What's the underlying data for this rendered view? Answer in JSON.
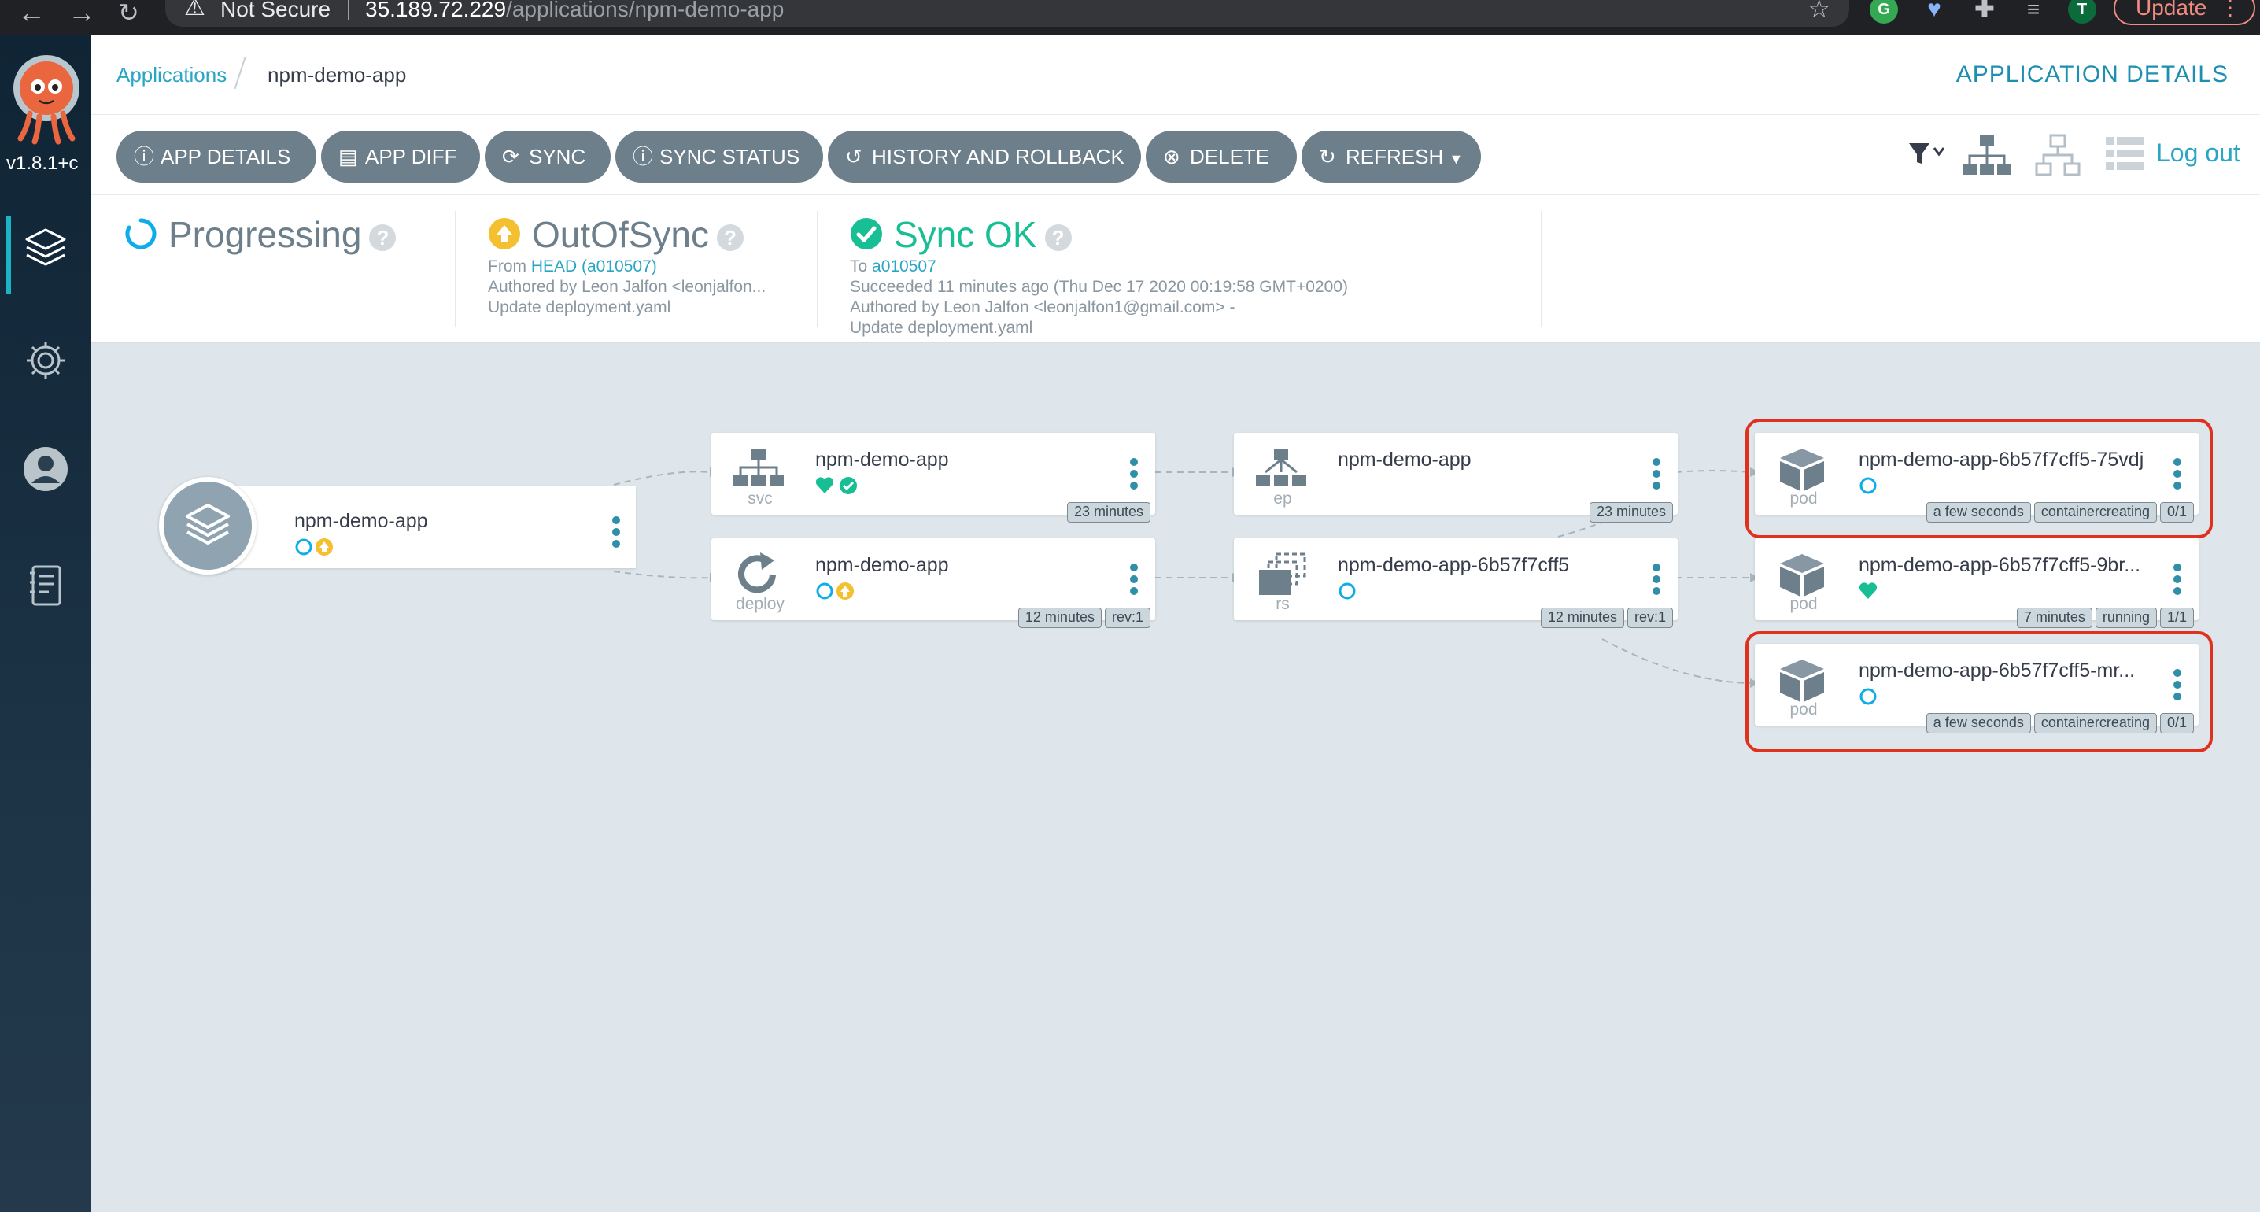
{
  "browser": {
    "security": "Not Secure",
    "url_host": "35.189.72.229",
    "url_path": "/applications/npm-demo-app",
    "profile_initial": "T",
    "update_label": "Update",
    "update_menu": "⋮"
  },
  "sidebar": {
    "version": "v1.8.1+c"
  },
  "header": {
    "breadcrumb_root": "Applications",
    "breadcrumb_current": "npm-demo-app",
    "page_title": "APPLICATION DETAILS"
  },
  "toolbar": {
    "buttons": [
      {
        "label": "APP DETAILS",
        "icon": "info-circle-icon"
      },
      {
        "label": "APP DIFF",
        "icon": "file-diff-icon"
      },
      {
        "label": "SYNC",
        "icon": "sync-icon"
      },
      {
        "label": "SYNC STATUS",
        "icon": "info-circle-icon"
      },
      {
        "label": "HISTORY AND ROLLBACK",
        "icon": "history-icon"
      },
      {
        "label": "DELETE",
        "icon": "times-circle-icon"
      },
      {
        "label": "REFRESH",
        "icon": "redo-icon"
      }
    ],
    "logout": "Log out"
  },
  "status": {
    "health": {
      "title": "Progressing"
    },
    "sync": {
      "title": "OutOfSync",
      "from_prefix": "From ",
      "from_link": "HEAD (a010507)",
      "author": "Authored by Leon Jalfon <leonjalfon...",
      "message": "Update deployment.yaml"
    },
    "operation": {
      "title": "Sync OK",
      "to_prefix": "To ",
      "to_link": "a010507",
      "result": "Succeeded 11 minutes ago (Thu Dec 17 2020 00:19:58 GMT+0200)",
      "author": "Authored by Leon Jalfon <leonjalfon1@gmail.com> -",
      "message": "Update deployment.yaml"
    },
    "help_glyph": "?"
  },
  "colors": {
    "accent": "#2aa6c5",
    "healthy": "#18be94",
    "progressing": "#0dadea",
    "out_of_sync": "#f4c030",
    "button": "#6d7f8b",
    "highlight": "#e0301e"
  },
  "graph": {
    "app": {
      "name": "npm-demo-app"
    },
    "nodes": [
      {
        "id": "svc",
        "name": "npm-demo-app",
        "kind": "svc",
        "tags": [
          "23 minutes"
        ]
      },
      {
        "id": "deploy",
        "name": "npm-demo-app",
        "kind": "deploy",
        "tags": [
          "12 minutes",
          "rev:1"
        ]
      },
      {
        "id": "ep",
        "name": "npm-demo-app",
        "kind": "ep",
        "tags": [
          "23 minutes"
        ]
      },
      {
        "id": "rs",
        "name": "npm-demo-app-6b57f7cff5",
        "kind": "rs",
        "tags": [
          "12 minutes",
          "rev:1"
        ]
      },
      {
        "id": "pod1",
        "name": "npm-demo-app-6b57f7cff5-75vdj",
        "kind": "pod",
        "tags": [
          "a few seconds",
          "containercreating",
          "0/1"
        ]
      },
      {
        "id": "pod2",
        "name": "npm-demo-app-6b57f7cff5-9br...",
        "kind": "pod",
        "tags": [
          "7 minutes",
          "running",
          "1/1"
        ]
      },
      {
        "id": "pod3",
        "name": "npm-demo-app-6b57f7cff5-mr...",
        "kind": "pod",
        "tags": [
          "a few seconds",
          "containercreating",
          "0/1"
        ]
      }
    ]
  }
}
